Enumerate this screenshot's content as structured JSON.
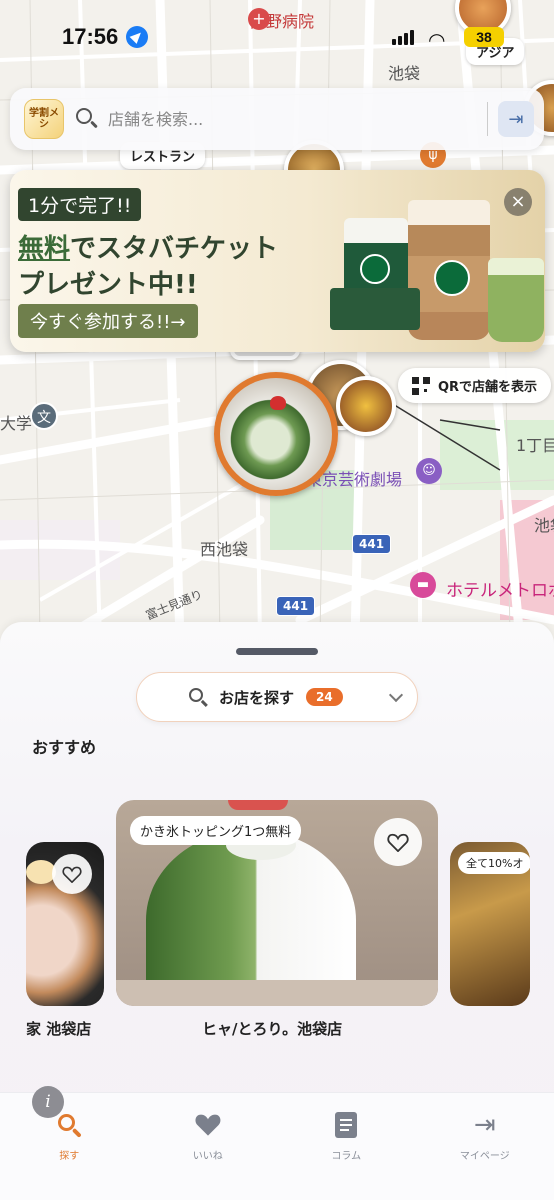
{
  "status_bar": {
    "time": "17:56",
    "battery": "38"
  },
  "search": {
    "logo_text": "学割メシ",
    "placeholder": "店舗を検索..."
  },
  "map": {
    "labels": {
      "hospital": "関野病院",
      "ikebukuro_top": "池袋",
      "asia": "アジア",
      "restaurant": "レストラン",
      "school": "大学",
      "chome": "1丁目",
      "theater": "東京芸術劇場",
      "nishi_ikebukuro": "西池袋",
      "ike_right": "池袋",
      "hotel": "ホテルメトロポ",
      "fujimi": "富士見通り",
      "route_441_a": "441",
      "route_441_b": "441"
    },
    "qr_button": "QRで店舗を表示"
  },
  "ad": {
    "tag": "1分で完了!!",
    "line1_highlight": "無料",
    "line1_rest": "でスタバチケット",
    "line2": "プレゼント中!!",
    "cta": "今すぐ参加する!!→"
  },
  "sheet": {
    "find_label": "お店を探す",
    "count": "24",
    "section_title": "おすすめ",
    "cards": [
      {
        "name": "家 池袋店"
      },
      {
        "name": "ヒャ/とろり。池袋店",
        "promo": "かき氷トッピング1つ無料"
      },
      {
        "name": "",
        "promo": "全て10%オ"
      }
    ]
  },
  "tabs": [
    {
      "label": "探す",
      "icon": "search-icon",
      "active": true
    },
    {
      "label": "いいね",
      "icon": "heart-icon",
      "active": false
    },
    {
      "label": "コラム",
      "icon": "document-icon",
      "active": false
    },
    {
      "label": "マイページ",
      "icon": "login-icon",
      "active": false
    }
  ],
  "colors": {
    "accent": "#e07a2f",
    "badge": "#e96e2b",
    "route": "#3a64b8"
  }
}
